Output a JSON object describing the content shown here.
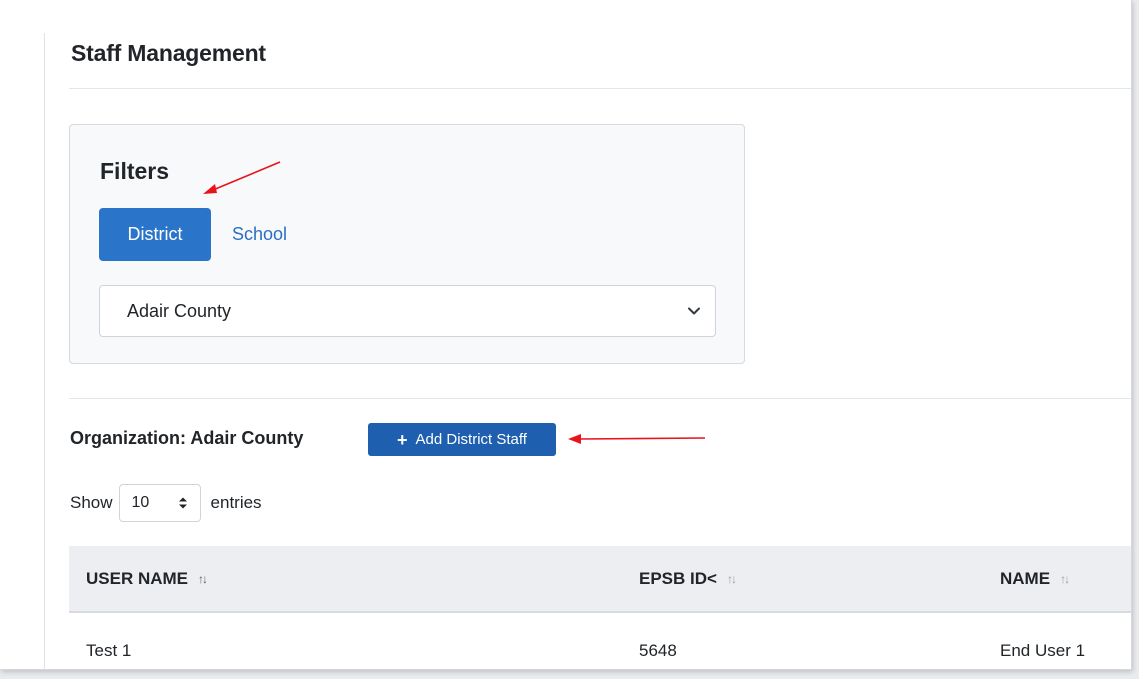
{
  "page": {
    "title": "Staff Management"
  },
  "filters": {
    "title": "Filters",
    "tabs": [
      {
        "label": "District",
        "active": true
      },
      {
        "label": "School",
        "active": false
      }
    ],
    "district_select": {
      "value": "Adair County",
      "icon": "chevron-down-icon"
    }
  },
  "organization": {
    "label": "Organization: Adair County",
    "add_button": {
      "icon": "plus-icon",
      "label": "Add District Staff"
    }
  },
  "length_menu": {
    "show": "Show",
    "value": "10",
    "entries": "entries"
  },
  "table": {
    "columns": [
      {
        "label": "USER NAME",
        "sort": "↑↓"
      },
      {
        "label": "EPSB ID<",
        "sort": "↑↓"
      },
      {
        "label": "NAME",
        "sort": "↑↓"
      }
    ],
    "rows": [
      {
        "user_name": "Test 1",
        "epsb_id": "5648",
        "name": "End User 1"
      }
    ]
  },
  "colors": {
    "primary": "#2a74c9",
    "button": "#1f5fb0",
    "link": "#2a6fc2",
    "annotation_arrow": "#e8141c"
  }
}
